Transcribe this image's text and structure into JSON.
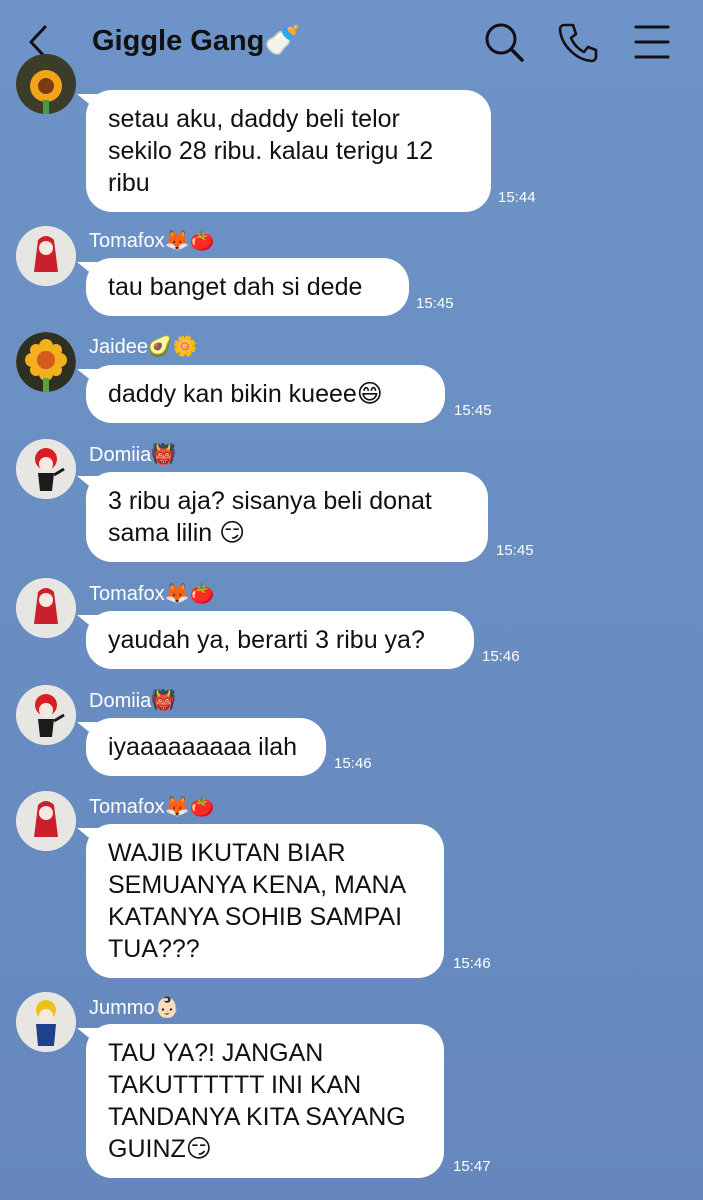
{
  "header": {
    "title": "Giggle Gang🍼",
    "back_icon": "chevron-left-icon",
    "search_icon": "search-icon",
    "call_icon": "phone-icon",
    "menu_icon": "menu-icon"
  },
  "messages": [
    {
      "sender": "",
      "text": "setau aku, daddy beli telor\nsekilo 28 ribu. kalau terigu 12\nribu",
      "time": "15:44"
    },
    {
      "sender": "Tomafox🦊🍅",
      "text": "tau banget dah si dede",
      "time": "15:45"
    },
    {
      "sender": "Jaidee🥑🌼",
      "text": "daddy kan bikin kueee😄",
      "time": "15:45"
    },
    {
      "sender": "Domiia👹",
      "text": "3 ribu aja? sisanya beli donat\nsama lilin 😏",
      "time": "15:45"
    },
    {
      "sender": "Tomafox🦊🍅",
      "text": "yaudah ya, berarti 3 ribu ya?",
      "time": "15:46"
    },
    {
      "sender": "Domiia👹",
      "text": "iyaaaaaaaaa ilah",
      "time": "15:46"
    },
    {
      "sender": "Tomafox🦊🍅",
      "text": "WAJIB IKUTAN BIAR\nSEMUANYA KENA, MANA\nKATANYA SOHIB SAMPAI\nTUA???",
      "time": "15:46"
    },
    {
      "sender": "Jummo👶🏻",
      "text": "TAU YA?! JANGAN\nTAKUTTTTTT INI KAN\nTANDANYA KITA SAYANG\nGUINZ😏",
      "time": "15:47"
    }
  ],
  "colors": {
    "background": "#6a8fc3",
    "bubble": "#ffffff",
    "text": "#111111",
    "meta_text": "#ffffff"
  }
}
